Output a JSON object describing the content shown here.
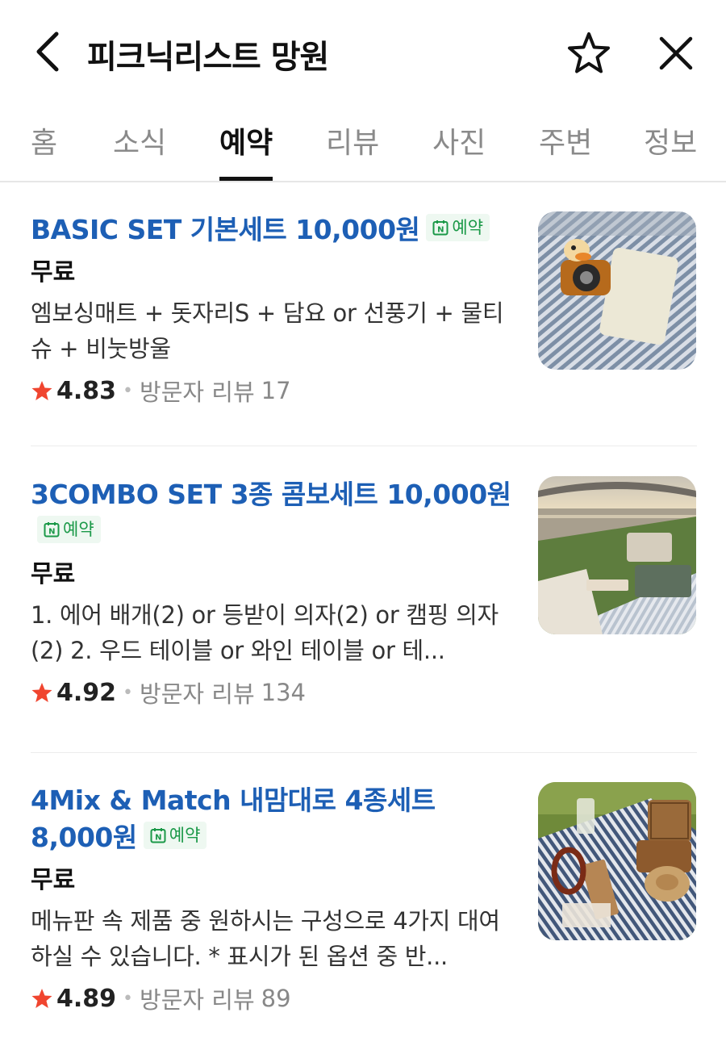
{
  "header": {
    "title": "피크닉리스트 망원"
  },
  "tabs": [
    {
      "label": "홈"
    },
    {
      "label": "소식"
    },
    {
      "label": "예약",
      "active": true
    },
    {
      "label": "리뷰"
    },
    {
      "label": "사진"
    },
    {
      "label": "주변"
    },
    {
      "label": "정보"
    }
  ],
  "badge_label": "예약",
  "colors": {
    "title_blue": "#1d5fb5",
    "badge_green": "#1b9948",
    "star_red": "#f0452f"
  },
  "items": [
    {
      "title": "BASIC SET 기본세트 10,000원",
      "price": "무료",
      "description": "엠보싱매트 + 돗자리S + 담요 or 선풍기 + 물티슈 + 비눗방울",
      "rating": "4.83",
      "review_label": "방문자 리뷰",
      "review_count": "17"
    },
    {
      "title": "3COMBO SET 3종 콤보세트 10,000원",
      "price": "무료",
      "description": "1. 에어 배개(2) or 등받이 의자(2) or 캠핑 의자(2) 2. 우드 테이블 or 와인 테이블 or 테...",
      "rating": "4.92",
      "review_label": "방문자 리뷰",
      "review_count": "134"
    },
    {
      "title": "4Mix & Match 내맘대로 4종세트 8,000원",
      "price": "무료",
      "description": "메뉴판 속 제품 중 원하시는 구성으로 4가지 대여하실 수 있습니다. * 표시가 된 옵션 중 반...",
      "rating": "4.89",
      "review_label": "방문자 리뷰",
      "review_count": "89"
    }
  ]
}
